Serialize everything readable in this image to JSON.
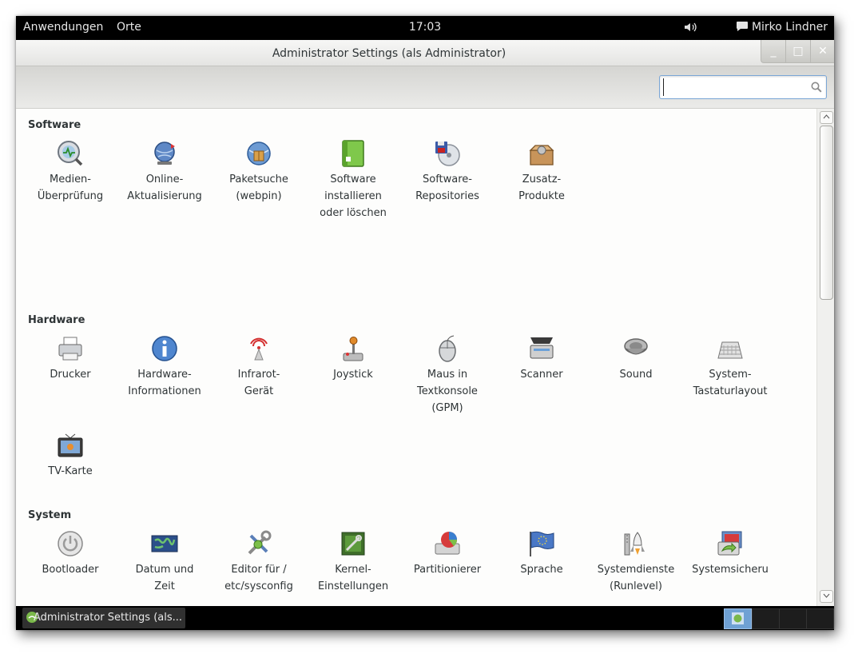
{
  "top_panel": {
    "applications": "Anwendungen",
    "places": "Orte",
    "clock": "17:03",
    "user": "Mirko Lindner"
  },
  "window": {
    "title": "Administrator Settings (als Administrator)",
    "minimize_symbol": "_",
    "maximize_symbol": "□",
    "close_symbol": "✕"
  },
  "search": {
    "value": "",
    "placeholder": ""
  },
  "sections": {
    "software": {
      "title": "Software",
      "items": [
        {
          "label": "Medien-\nÜberprüfung",
          "icon": "media-check-icon"
        },
        {
          "label": "Online-\nAktualisierung",
          "icon": "online-update-icon"
        },
        {
          "label": "Paketsuche\n(webpin)",
          "icon": "package-search-icon"
        },
        {
          "label": "Software\ninstallieren\noder löschen",
          "icon": "software-install-icon"
        },
        {
          "label": "Software-\nRepositories",
          "icon": "repositories-icon"
        },
        {
          "label": "Zusatz-\nProdukte",
          "icon": "addon-products-icon"
        }
      ]
    },
    "hardware": {
      "title": "Hardware",
      "items": [
        {
          "label": "Drucker",
          "icon": "printer-icon"
        },
        {
          "label": "Hardware-\nInformationen",
          "icon": "hardware-info-icon"
        },
        {
          "label": "Infrarot-\nGerät",
          "icon": "infrared-icon"
        },
        {
          "label": "Joystick",
          "icon": "joystick-icon"
        },
        {
          "label": "Maus in\nTextkonsole\n(GPM)",
          "icon": "mouse-icon"
        },
        {
          "label": "Scanner",
          "icon": "scanner-icon"
        },
        {
          "label": "Sound",
          "icon": "sound-icon"
        },
        {
          "label": "System-\nTastaturlayout",
          "icon": "keyboard-icon"
        },
        {
          "label": "TV-Karte",
          "icon": "tv-card-icon"
        }
      ]
    },
    "system": {
      "title": "System",
      "items": [
        {
          "label": "Bootloader",
          "icon": "bootloader-icon"
        },
        {
          "label": "Datum und\nZeit",
          "icon": "date-time-icon"
        },
        {
          "label": "Editor für /\netc/sysconfig",
          "icon": "sysconfig-editor-icon"
        },
        {
          "label": "Kernel-\nEinstellungen",
          "icon": "kernel-settings-icon"
        },
        {
          "label": "Partitionierer",
          "icon": "partitioner-icon"
        },
        {
          "label": "Sprache",
          "icon": "language-icon"
        },
        {
          "label": "Systemdienste\n(Runlevel)",
          "icon": "system-services-icon"
        },
        {
          "label": "Systemsicheru",
          "icon": "system-backup-icon"
        }
      ]
    }
  },
  "taskbar": {
    "task_label": "Administrator Settings (als..."
  },
  "colors": {
    "panel": "#000000",
    "selection": "#7aa6d6",
    "content_bg": "#fdfdfc"
  }
}
